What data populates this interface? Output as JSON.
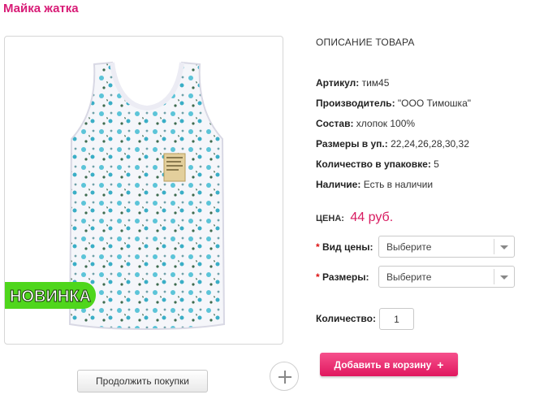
{
  "product": {
    "title": "Майка жатка"
  },
  "image": {
    "badge_text": "НОВИНКА"
  },
  "description": {
    "heading": "ОПИСАНИЕ ТОВАРА",
    "attributes": [
      {
        "label": "Артикул:",
        "value": "тим45"
      },
      {
        "label": "Производитель:",
        "value": "\"ООО Тимошка\""
      },
      {
        "label": "Состав:",
        "value": "хлопок 100%"
      },
      {
        "label": "Размеры в уп.:",
        "value": "22,24,26,28,30,32"
      },
      {
        "label": "Количество в упаковке:",
        "value": "5"
      },
      {
        "label": "Наличие:",
        "value": "Есть в наличии"
      }
    ]
  },
  "price": {
    "label": "ЦЕНА:",
    "value": "44 руб."
  },
  "options": {
    "required_mark": "*",
    "price_type": {
      "label": "Вид цены:",
      "selected": "Выберите"
    },
    "sizes": {
      "label": "Размеры:",
      "selected": "Выберите"
    }
  },
  "quantity": {
    "label": "Количество:",
    "value": "1"
  },
  "buttons": {
    "continue_shopping": "Продолжить покупки",
    "add_to_cart": "Добавить в корзину",
    "add_to_cart_icon": "+"
  },
  "colors": {
    "brand_pink": "#d81b76",
    "price_color": "#d81b60",
    "badge_green": "#4fd61c"
  },
  "icons": {
    "zoom": "plus-icon",
    "select_arrow": "chevron-down-icon"
  }
}
